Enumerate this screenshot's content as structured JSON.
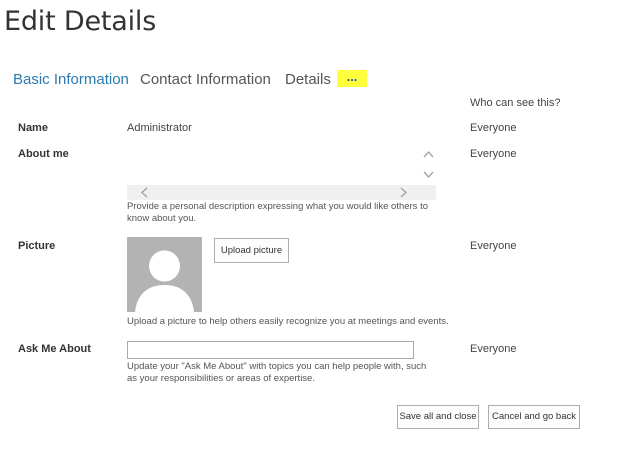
{
  "page": {
    "title": "Edit Details"
  },
  "tabs": [
    {
      "label": "Basic Information",
      "active": true
    },
    {
      "label": "Contact Information",
      "active": false
    },
    {
      "label": "Details",
      "active": false
    }
  ],
  "more_tab": {
    "label": "..."
  },
  "visibility_header": "Who can see this?",
  "fields": {
    "name": {
      "label": "Name",
      "value": "Administrator",
      "visibility": "Everyone"
    },
    "about": {
      "label": "About me",
      "value": "",
      "hint": "Provide a personal description expressing what you would like others to know about you.",
      "visibility": "Everyone"
    },
    "picture": {
      "label": "Picture",
      "upload_button": "Upload picture",
      "hint": "Upload a picture to help others easily recognize you at meetings and events.",
      "visibility": "Everyone"
    },
    "ask_me_about": {
      "label": "Ask Me About",
      "value": "",
      "hint": "Update your \"Ask Me About\" with topics you can help people with, such as your responsibilities or areas of expertise.",
      "visibility": "Everyone"
    }
  },
  "actions": {
    "save_label": "Save all and close",
    "cancel_label": "Cancel and go back"
  },
  "icons": {
    "scroll_up": "chevron-up-icon",
    "scroll_down": "chevron-down-icon",
    "scroll_left": "chevron-left-icon",
    "scroll_right": "chevron-right-icon",
    "avatar_placeholder": "person-silhouette-icon"
  },
  "colors": {
    "active_tab": "#2a7ab0",
    "more_tab_highlight": "#ffff3b",
    "avatar_bg": "#b3b3b3"
  }
}
